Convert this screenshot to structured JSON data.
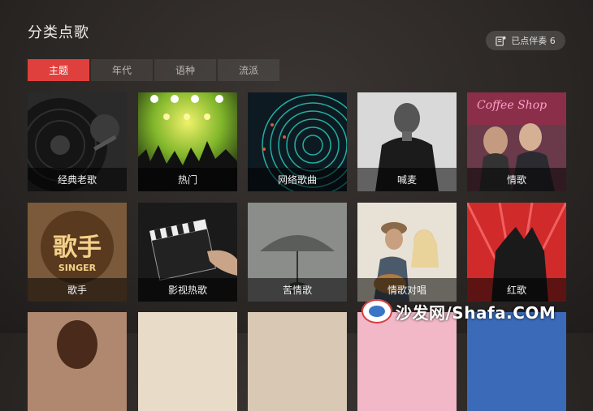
{
  "header": {
    "title": "分类点歌",
    "queue_label": "已点伴奏 6"
  },
  "tabs": [
    {
      "label": "主题",
      "active": true
    },
    {
      "label": "年代",
      "active": false
    },
    {
      "label": "语种",
      "active": false
    },
    {
      "label": "流派",
      "active": false
    }
  ],
  "categories": [
    {
      "label": "经典老歌"
    },
    {
      "label": "热门"
    },
    {
      "label": "网络歌曲"
    },
    {
      "label": "喊麦"
    },
    {
      "label": "情歌"
    },
    {
      "label": "歌手"
    },
    {
      "label": "影视热歌"
    },
    {
      "label": "苦情歌"
    },
    {
      "label": "情歌对唱"
    },
    {
      "label": "红歌"
    }
  ],
  "art_text": {
    "coffee_shop": "Coffee Shop",
    "singer_logo": "歌手",
    "singer_sub": "SINGER"
  },
  "watermark": {
    "text": "沙发网/Shafa.COM"
  },
  "colors": {
    "accent": "#e0403d",
    "background": "#2b2725"
  }
}
